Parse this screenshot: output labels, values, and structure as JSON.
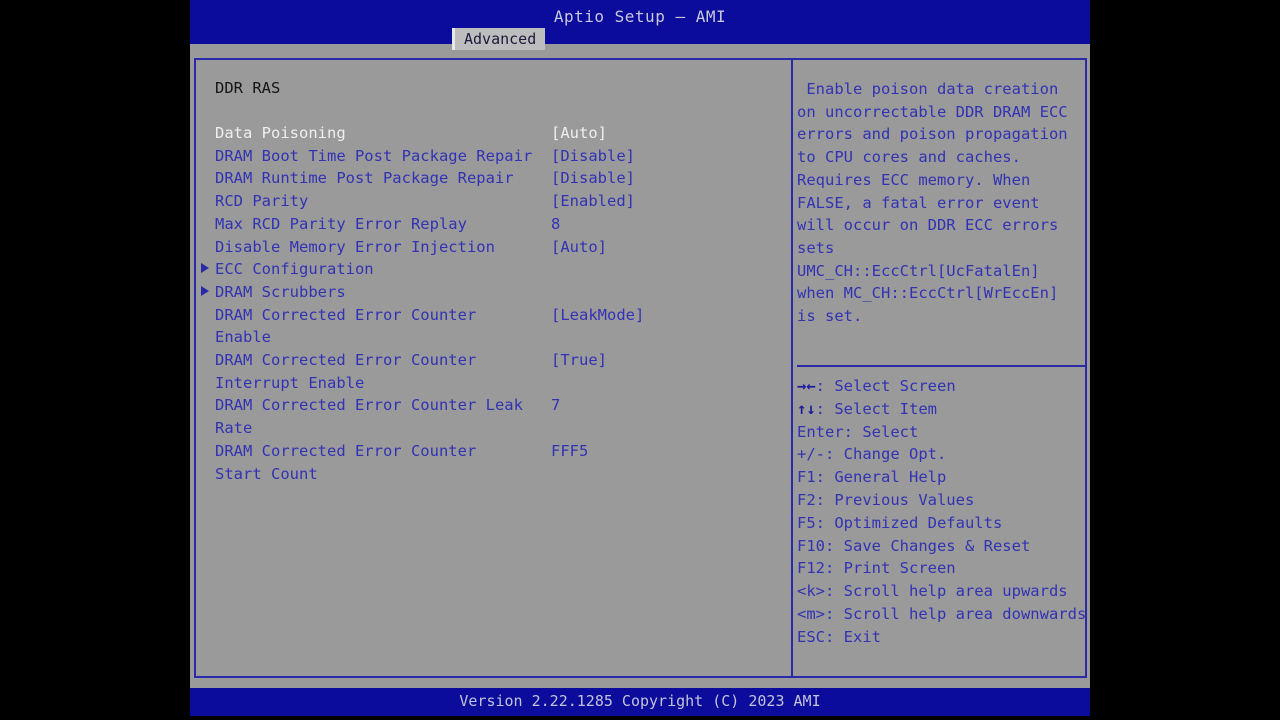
{
  "header": {
    "title": "Aptio Setup – AMI",
    "active_tab": "Advanced",
    "tabs": [
      "Advanced"
    ]
  },
  "left_panel": {
    "section_title": "DDR RAS",
    "items": [
      {
        "label": "Data Poisoning",
        "value": "[Auto]",
        "submenu": false,
        "selected": true,
        "cont": ""
      },
      {
        "label": "DRAM Boot Time Post Package Repair",
        "value": "[Disable]",
        "submenu": false,
        "selected": false,
        "cont": ""
      },
      {
        "label": "DRAM Runtime Post Package Repair",
        "value": "[Disable]",
        "submenu": false,
        "selected": false,
        "cont": ""
      },
      {
        "label": "RCD Parity",
        "value": "[Enabled]",
        "submenu": false,
        "selected": false,
        "cont": ""
      },
      {
        "label": "Max RCD Parity Error Replay",
        "value": "8",
        "submenu": false,
        "selected": false,
        "cont": ""
      },
      {
        "label": "Disable Memory Error Injection",
        "value": "[Auto]",
        "submenu": false,
        "selected": false,
        "cont": ""
      },
      {
        "label": "ECC Configuration",
        "value": "",
        "submenu": true,
        "selected": false,
        "cont": ""
      },
      {
        "label": "DRAM Scrubbers",
        "value": "",
        "submenu": true,
        "selected": false,
        "cont": ""
      },
      {
        "label": "DRAM Corrected Error Counter",
        "value": "[LeakMode]",
        "submenu": false,
        "selected": false,
        "cont": "Enable"
      },
      {
        "label": "DRAM Corrected Error Counter",
        "value": "[True]",
        "submenu": false,
        "selected": false,
        "cont": "Interrupt Enable"
      },
      {
        "label": "DRAM Corrected Error Counter Leak",
        "value": "7",
        "submenu": false,
        "selected": false,
        "cont": "Rate"
      },
      {
        "label": "DRAM Corrected Error Counter",
        "value": "FFF5",
        "submenu": false,
        "selected": false,
        "cont": "Start Count"
      }
    ]
  },
  "right_panel": {
    "help_lines": [
      " Enable poison data creation",
      "on uncorrectable DDR DRAM ECC",
      "errors and poison propagation",
      "to CPU cores and caches.",
      "Requires ECC memory. When",
      "FALSE, a fatal error event",
      "will occur on DDR ECC errors",
      "sets",
      "UMC_CH::EccCtrl[UcFatalEn]",
      "when MC_CH::EccCtrl[WrEccEn]",
      "is set."
    ],
    "key_legend": [
      {
        "glyph": "→←",
        "text": ": Select Screen"
      },
      {
        "glyph": "↑↓",
        "text": ": Select Item"
      },
      {
        "glyph": "",
        "text": "Enter: Select"
      },
      {
        "glyph": "",
        "text": "+/-: Change Opt."
      },
      {
        "glyph": "",
        "text": "F1: General Help"
      },
      {
        "glyph": "",
        "text": "F2: Previous Values"
      },
      {
        "glyph": "",
        "text": "F5: Optimized Defaults"
      },
      {
        "glyph": "",
        "text": "F10: Save Changes & Reset"
      },
      {
        "glyph": "",
        "text": "F12: Print Screen"
      },
      {
        "glyph": "",
        "text": "<k>: Scroll help area upwards"
      },
      {
        "glyph": "",
        "text": "<m>: Scroll help area downwards"
      },
      {
        "glyph": "",
        "text": "ESC: Exit"
      }
    ]
  },
  "footer": {
    "version_text": "Version 2.22.1285 Copyright (C) 2023 AMI"
  },
  "colors": {
    "header_blue": "#0c0c9c",
    "panel_gray": "#9a9a9a",
    "text_blue": "#3232b4",
    "selected_white": "#efefef",
    "border_blue": "#2a2aa8",
    "tab_gray": "#bdbdbd"
  }
}
